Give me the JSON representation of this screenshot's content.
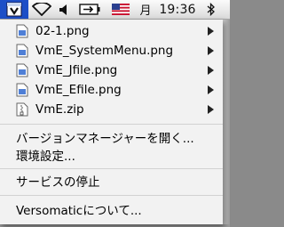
{
  "menubar": {
    "month_label": "月",
    "clock": "19:36",
    "icons": [
      "vme-menu-icon",
      "wifi-icon",
      "volume-icon",
      "battery-icon",
      "us-flag-icon",
      "bluetooth-icon"
    ]
  },
  "menu": {
    "files": [
      {
        "label": "02-1.png"
      },
      {
        "label": "VmE_SystemMenu.png"
      },
      {
        "label": "VmE_Jfile.png"
      },
      {
        "label": "VmE_Efile.png"
      },
      {
        "label": "VmE.zip"
      }
    ],
    "open_version_manager": "バージョンマネージャーを開く...",
    "settings": "環境設定...",
    "stop_service": "サービスの停止",
    "about": "Versomaticについて..."
  },
  "colors": {
    "active_tab": "#1d4fc7",
    "menu_bg": "#f6f6f6"
  }
}
